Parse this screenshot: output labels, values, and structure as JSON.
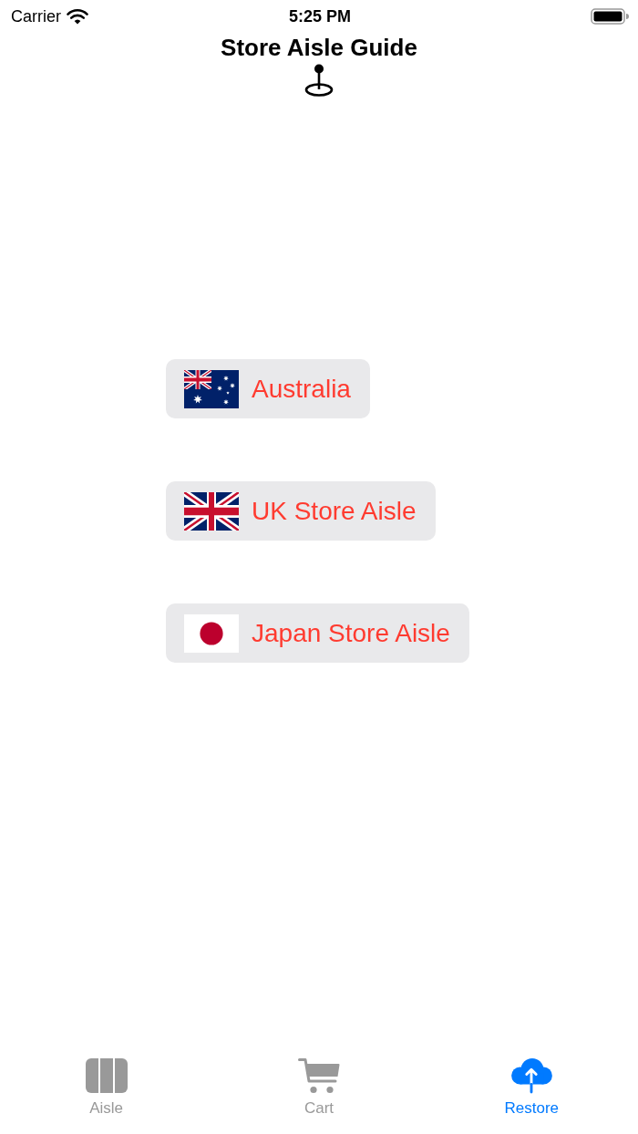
{
  "status_bar": {
    "carrier": "Carrier",
    "time": "5:25 PM"
  },
  "header": {
    "title": "Store Aisle Guide"
  },
  "store_buttons": [
    {
      "label": "Australia"
    },
    {
      "label": "UK Store Aisle"
    },
    {
      "label": "Japan Store Aisle"
    }
  ],
  "tab_bar": [
    {
      "label": "Aisle",
      "selected": false
    },
    {
      "label": "Cart",
      "selected": false
    },
    {
      "label": "Restore",
      "selected": true
    }
  ]
}
